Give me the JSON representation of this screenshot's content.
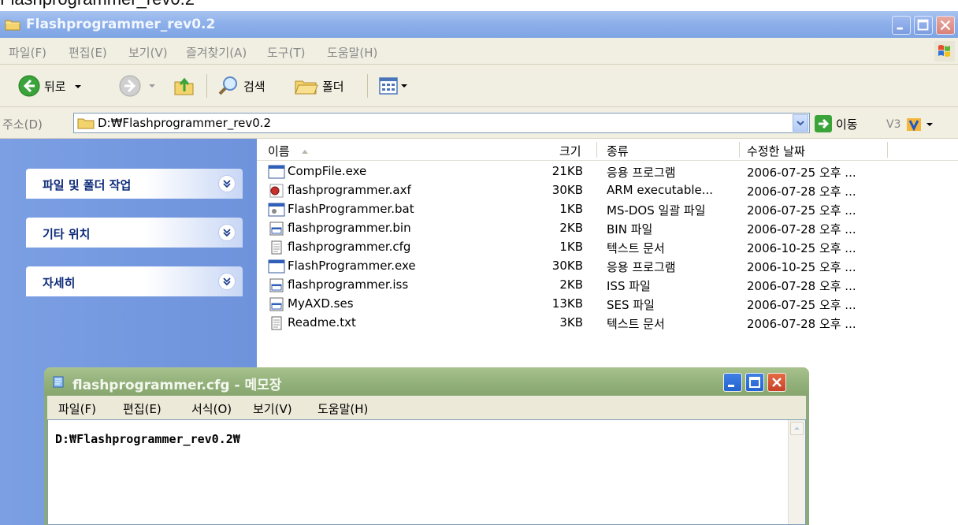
{
  "page_caption": "Flashprogrammer_rev0.2",
  "explorer": {
    "title": "Flashprogrammer_rev0.2",
    "menu": [
      "파일(F)",
      "편집(E)",
      "보기(V)",
      "즐겨찾기(A)",
      "도구(T)",
      "도움말(H)"
    ],
    "toolbar": {
      "back_label": "뒤로",
      "search_label": "검색",
      "folders_label": "폴더"
    },
    "address": {
      "label": "주소(D)",
      "value": "D:₩Flashprogrammer_rev0.2",
      "go_label": "이동",
      "v3_label": "V3"
    },
    "task_panels": [
      {
        "title": "파일 및 폴더 작업"
      },
      {
        "title": "기타 위치"
      },
      {
        "title": "자세히"
      }
    ],
    "columns": {
      "name": "이름",
      "size": "크기",
      "type": "종류",
      "modified": "수정한 날짜"
    },
    "files": [
      {
        "name": "CompFile.exe",
        "size": "21KB",
        "type": "응용 프로그램",
        "modified": "2006-07-25 오후 ...",
        "icon": "exe-icon"
      },
      {
        "name": "flashprogrammer.axf",
        "size": "30KB",
        "type": "ARM executable...",
        "modified": "2006-07-28 오후 ...",
        "icon": "axf-icon"
      },
      {
        "name": "FlashProgrammer.bat",
        "size": "1KB",
        "type": "MS-DOS 일괄 파일",
        "modified": "2006-07-25 오후 ...",
        "icon": "bat-icon"
      },
      {
        "name": "flashprogrammer.bin",
        "size": "2KB",
        "type": "BIN 파일",
        "modified": "2006-07-28 오후 ...",
        "icon": "generic-file-icon"
      },
      {
        "name": "flashprogrammer.cfg",
        "size": "1KB",
        "type": "텍스트 문서",
        "modified": "2006-10-25 오후 ...",
        "icon": "text-file-icon"
      },
      {
        "name": "FlashProgrammer.exe",
        "size": "30KB",
        "type": "응용 프로그램",
        "modified": "2006-10-25 오후 ...",
        "icon": "exe-icon"
      },
      {
        "name": "flashprogrammer.iss",
        "size": "2KB",
        "type": "ISS 파일",
        "modified": "2006-07-28 오후 ...",
        "icon": "generic-file-icon"
      },
      {
        "name": "MyAXD.ses",
        "size": "13KB",
        "type": "SES 파일",
        "modified": "2006-07-25 오후 ...",
        "icon": "generic-file-icon"
      },
      {
        "name": "Readme.txt",
        "size": "3KB",
        "type": "텍스트 문서",
        "modified": "2006-07-28 오후 ...",
        "icon": "text-file-icon"
      }
    ]
  },
  "notepad": {
    "title": "flashprogrammer.cfg - 메모장",
    "menu": [
      "파일(F)",
      "편집(E)",
      "서식(O)",
      "보기(V)",
      "도움말(H)"
    ],
    "content": "D:₩Flashprogrammer_rev0.2₩"
  },
  "colors": {
    "xp_inactive_blue": "#8db0ea",
    "task_pane_blue": "#7c9fe3",
    "notepad_inactive_green": "#94b27b"
  }
}
